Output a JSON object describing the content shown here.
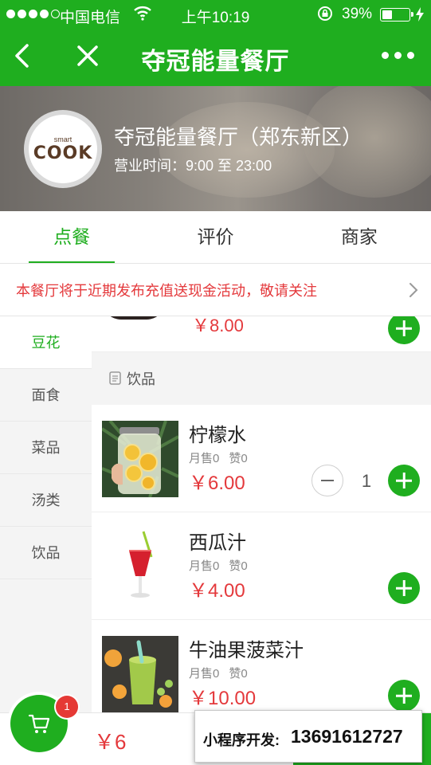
{
  "status_bar": {
    "carrier": "中国电信",
    "time": "上午10:19",
    "battery": "39%",
    "battery_level": 0.39,
    "icons": [
      "signal-dots",
      "wifi-icon",
      "rotation-lock-icon",
      "battery-icon",
      "charging-icon"
    ]
  },
  "nav": {
    "title": "夺冠能量餐厅",
    "icons": [
      "back-icon",
      "close-icon",
      "more-icon"
    ]
  },
  "restaurant": {
    "logo_text_top": "smart",
    "logo_text": "COOK",
    "name": "夺冠能量餐厅（郑东新区）",
    "hours_label": "营业时间：",
    "hours_value": "9:00 至 23:00"
  },
  "tabs": [
    {
      "label": "点餐",
      "active": true
    },
    {
      "label": "评价",
      "active": false
    },
    {
      "label": "商家",
      "active": false
    }
  ],
  "notice": "本餐厅将于近期发布充值送现金活动，敬请关注",
  "categories": [
    {
      "label": "豆花",
      "active": true
    },
    {
      "label": "面食",
      "active": false
    },
    {
      "label": "菜品",
      "active": false
    },
    {
      "label": "汤类",
      "active": false
    },
    {
      "label": "饮品",
      "active": false
    }
  ],
  "partial_item": {
    "price": "￥8.00"
  },
  "section": {
    "title": "饮品"
  },
  "items": [
    {
      "name": "柠檬水",
      "sold": "月售0",
      "likes": "赞0",
      "price": "￥6.00",
      "quantity": "1"
    },
    {
      "name": "西瓜汁",
      "sold": "月售0",
      "likes": "赞0",
      "price": "￥4.00"
    },
    {
      "name": "牛油果菠菜汁",
      "sold": "月售0",
      "likes": "赞0",
      "price": "￥10.00"
    }
  ],
  "cart": {
    "badge": "1",
    "total": "￥6"
  },
  "dev_overlay": {
    "label": "小程序开发:",
    "phone": "13691612727"
  },
  "colors": {
    "brand_green": "#1fae1f",
    "price_red": "#e4393c",
    "badge_red": "#e53935"
  }
}
